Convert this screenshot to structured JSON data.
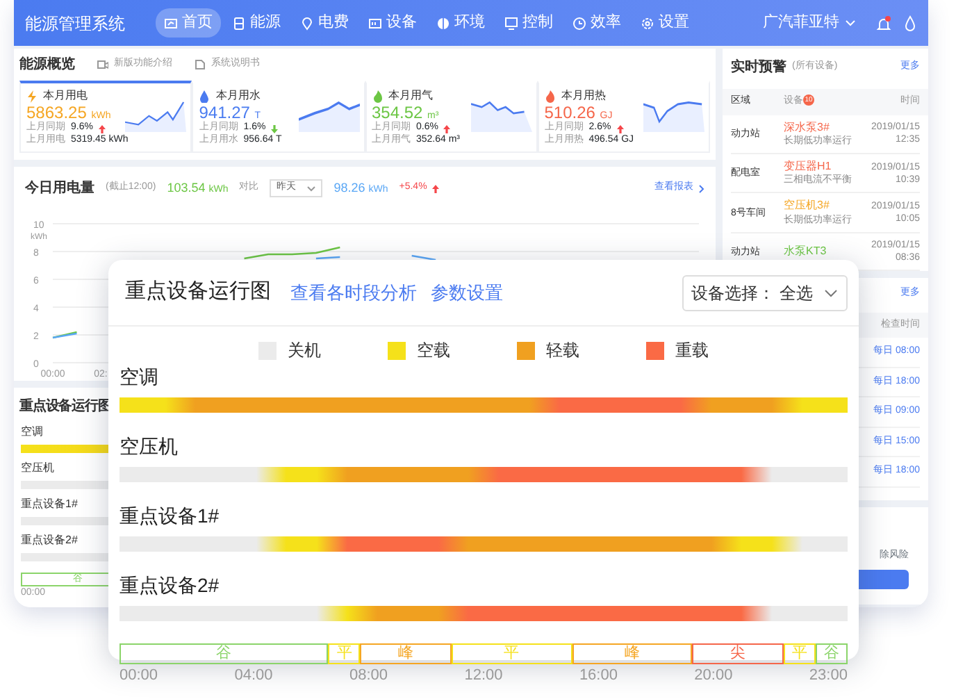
{
  "nav": {
    "title": "能源管理系统",
    "items": [
      {
        "label": "首页",
        "selected": true
      },
      {
        "label": "能源",
        "selected": false
      },
      {
        "label": "电费",
        "selected": false
      },
      {
        "label": "设备",
        "selected": false
      },
      {
        "label": "环境",
        "selected": false
      },
      {
        "label": "控制",
        "selected": false
      },
      {
        "label": "效率",
        "selected": false
      },
      {
        "label": "设置",
        "selected": false
      }
    ],
    "company": "广汽菲亚特",
    "bell_alert": true
  },
  "overview": {
    "title": "能源概览",
    "links": [
      {
        "label": "新版功能介绍",
        "kind": "video"
      },
      {
        "label": "系统说明书",
        "kind": "doc"
      }
    ],
    "tiles": [
      {
        "kind": "electric",
        "label": "本月用电",
        "value": "5863.25",
        "unit": "kWh",
        "color": "#f5a623",
        "yoy_label": "上月同期",
        "yoy": "9.6%",
        "rising": true,
        "last_label": "上月用电",
        "last_value": "5319.45 kWh",
        "selected": true
      },
      {
        "kind": "water",
        "label": "本月用水",
        "value": "941.27",
        "unit": "T",
        "color": "#4a7cf0",
        "yoy_label": "上月同期",
        "yoy": "1.6%",
        "rising": false,
        "last_label": "上月用水",
        "last_value": "956.64 T",
        "selected": false
      },
      {
        "kind": "gas",
        "label": "本月用气",
        "value": "354.52",
        "unit": "m³",
        "color": "#6cc644",
        "yoy_label": "上月同期",
        "yoy": "0.6%",
        "rising": true,
        "last_label": "上月用气",
        "last_value": "352.64 m³",
        "selected": false
      },
      {
        "kind": "heat",
        "label": "本月用热",
        "value": "510.26",
        "unit": "GJ",
        "color": "#f5664a",
        "yoy_label": "上月同期",
        "yoy": "2.6%",
        "rising": true,
        "last_label": "上月用热",
        "last_value": "496.54 GJ",
        "selected": false
      }
    ]
  },
  "today": {
    "title": "今日用电量",
    "note": "(截止12:00)",
    "value": "103.54",
    "unit": "kWh",
    "compare_label": "对比",
    "select": "昨天",
    "compare_value": "98.26",
    "compare_unit": "kWh",
    "change": "+5.4%",
    "change_rising": true,
    "report_link": "查看报表",
    "chart_data": {
      "type": "line",
      "ylabel": "kWh",
      "x": [
        0,
        1,
        2,
        3,
        4,
        5,
        6,
        7,
        8,
        9,
        10,
        11,
        12,
        13,
        14,
        15,
        16
      ],
      "xlim": [
        0,
        27
      ],
      "ylim": [
        0,
        10
      ],
      "grid": true,
      "yticks": [
        0,
        2,
        4,
        6,
        8,
        10
      ],
      "xticks": [
        {
          "value": 0,
          "label": "00:00"
        },
        {
          "value": 2,
          "label": "02:"
        }
      ],
      "series": [
        {
          "color": "#6cc644",
          "values": [
            1.8,
            2.2,
            null,
            null,
            null,
            null,
            null,
            null,
            7.5,
            7.8,
            7.8,
            7.9,
            8.3,
            null,
            null,
            null,
            null
          ]
        },
        {
          "color": "#5aa7f5",
          "values": [
            1.8,
            2.1,
            null,
            null,
            null,
            null,
            null,
            null,
            null,
            null,
            null,
            7.5,
            7.6,
            null,
            null,
            7.7,
            7.4
          ]
        }
      ]
    }
  },
  "key_small": {
    "title": "重点设备运行图",
    "rows": [
      {
        "label": "空调",
        "running": true
      },
      {
        "label": "空压机",
        "running": false
      },
      {
        "label": "重点设备1#",
        "running": false
      },
      {
        "label": "重点设备2#",
        "running": false
      }
    ],
    "band": [
      {
        "label": "谷",
        "kind": "valley"
      }
    ],
    "ticks": [
      "00:00"
    ]
  },
  "alerts": {
    "title": "实时预警",
    "scope": "(所有设备)",
    "more": "更多",
    "columns": [
      "区域",
      "设备",
      "时间"
    ],
    "badge": "10",
    "rows": [
      {
        "area": "动力站",
        "device": "深水泵3#",
        "color": "#f5664a",
        "desc": "长期低功率运行",
        "date": "2019/01/15",
        "time": "12:35"
      },
      {
        "area": "配电室",
        "device": "变压器H1",
        "color": "#f5664a",
        "desc": "三相电流不平衡",
        "date": "2019/01/15",
        "time": "10:39"
      },
      {
        "area": "8号车间",
        "device": "空压机3#",
        "color": "#f5a623",
        "desc": "长期低功率运行",
        "date": "2019/01/15",
        "time": "10:05"
      },
      {
        "area": "动力站",
        "device": "水泵KT3",
        "color": "#6cc644",
        "date": "2019/01/15",
        "time": "08:36"
      }
    ]
  },
  "checks": {
    "more": "更多",
    "column": "检查时间",
    "rows": [
      {
        "time": "每日 08:00"
      },
      {
        "time": "每日 18:00"
      },
      {
        "time": "每日 09:00"
      },
      {
        "time": "每日 15:00"
      },
      {
        "time": "每日 18:00"
      }
    ]
  },
  "risk": {
    "text": "除风险"
  },
  "overlay": {
    "title": "重点设备运行图",
    "links": [
      "查看各时段分析",
      "参数设置"
    ],
    "select_label": "设备选择：",
    "select_value": "全选",
    "legend": [
      {
        "kind": "off",
        "label": "关机"
      },
      {
        "kind": "idle",
        "label": "空载"
      },
      {
        "kind": "light",
        "label": "轻载"
      },
      {
        "kind": "heavy",
        "label": "重载"
      }
    ],
    "rows": [
      {
        "label": "空调",
        "states": [
          {
            "kind": "idle"
          },
          {
            "kind": "idle"
          },
          {
            "kind": "light"
          },
          {
            "kind": "light"
          },
          {
            "kind": "light"
          },
          {
            "kind": "light"
          },
          {
            "kind": "light"
          },
          {
            "kind": "light"
          },
          {
            "kind": "light"
          },
          {
            "kind": "light"
          },
          {
            "kind": "light"
          },
          {
            "kind": "light"
          },
          {
            "kind": "light"
          },
          {
            "kind": "light"
          },
          {
            "kind": "heavy"
          },
          {
            "kind": "heavy"
          },
          {
            "kind": "heavy"
          },
          {
            "kind": "heavy"
          },
          {
            "kind": "heavy"
          },
          {
            "kind": "light"
          },
          {
            "kind": "light"
          },
          {
            "kind": "light"
          },
          {
            "kind": "idle"
          },
          {
            "kind": "idle"
          }
        ]
      },
      {
        "label": "空压机",
        "states": [
          {
            "kind": "off"
          },
          {
            "kind": "off"
          },
          {
            "kind": "off"
          },
          {
            "kind": "off"
          },
          {
            "kind": "off"
          },
          {
            "kind": "idle"
          },
          {
            "kind": "idle"
          },
          {
            "kind": "light"
          },
          {
            "kind": "light"
          },
          {
            "kind": "light"
          },
          {
            "kind": "light"
          },
          {
            "kind": "light"
          },
          {
            "kind": "heavy"
          },
          {
            "kind": "heavy"
          },
          {
            "kind": "heavy"
          },
          {
            "kind": "heavy"
          },
          {
            "kind": "heavy"
          },
          {
            "kind": "heavy"
          },
          {
            "kind": "heavy"
          },
          {
            "kind": "heavy"
          },
          {
            "kind": "heavy"
          },
          {
            "kind": "off"
          },
          {
            "kind": "off"
          },
          {
            "kind": "off"
          }
        ]
      },
      {
        "label": "重点设备1#",
        "states": [
          {
            "kind": "off"
          },
          {
            "kind": "off"
          },
          {
            "kind": "off"
          },
          {
            "kind": "off"
          },
          {
            "kind": "off"
          },
          {
            "kind": "idle"
          },
          {
            "kind": "idle"
          },
          {
            "kind": "heavy"
          },
          {
            "kind": "heavy"
          },
          {
            "kind": "heavy"
          },
          {
            "kind": "heavy"
          },
          {
            "kind": "light"
          },
          {
            "kind": "light"
          },
          {
            "kind": "light"
          },
          {
            "kind": "light"
          },
          {
            "kind": "light"
          },
          {
            "kind": "light"
          },
          {
            "kind": "light"
          },
          {
            "kind": "light"
          },
          {
            "kind": "light"
          },
          {
            "kind": "idle"
          },
          {
            "kind": "idle"
          },
          {
            "kind": "off"
          },
          {
            "kind": "off"
          }
        ]
      },
      {
        "label": "重点设备2#",
        "states": [
          {
            "kind": "off"
          },
          {
            "kind": "off"
          },
          {
            "kind": "off"
          },
          {
            "kind": "off"
          },
          {
            "kind": "off"
          },
          {
            "kind": "off"
          },
          {
            "kind": "off"
          },
          {
            "kind": "idle"
          },
          {
            "kind": "light"
          },
          {
            "kind": "light"
          },
          {
            "kind": "light"
          },
          {
            "kind": "heavy"
          },
          {
            "kind": "heavy"
          },
          {
            "kind": "heavy"
          },
          {
            "kind": "heavy"
          },
          {
            "kind": "heavy"
          },
          {
            "kind": "heavy"
          },
          {
            "kind": "heavy"
          },
          {
            "kind": "heavy"
          },
          {
            "kind": "heavy"
          },
          {
            "kind": "heavy"
          },
          {
            "kind": "off"
          },
          {
            "kind": "off"
          },
          {
            "kind": "off"
          }
        ]
      }
    ],
    "band": [
      {
        "label": "谷",
        "kind": "valley"
      },
      {
        "label": "平",
        "kind": "flat"
      },
      {
        "label": "峰",
        "kind": "peak"
      },
      {
        "label": "平",
        "kind": "flat"
      },
      {
        "label": "峰",
        "kind": "peak"
      },
      {
        "label": "尖",
        "kind": "sharp"
      },
      {
        "label": "平",
        "kind": "flat"
      },
      {
        "label": "谷",
        "kind": "valley"
      }
    ],
    "ticks": [
      "00:00",
      "04:00",
      "08:00",
      "12:00",
      "16:00",
      "20:00",
      "23:00"
    ]
  }
}
